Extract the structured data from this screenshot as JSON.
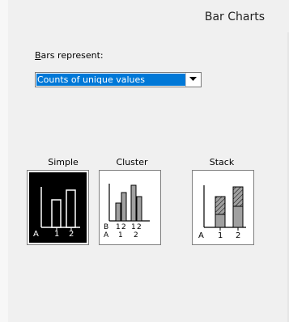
{
  "window": {
    "title": "Bar Charts"
  },
  "bars_represent": {
    "label_prefix": "",
    "label_underlined": "B",
    "label_rest": "ars represent:",
    "selected_value": "Counts of unique values"
  },
  "chart_types": [
    {
      "label": "Simple",
      "selected": true,
      "axis": {
        "row1": "",
        "row2": [
          "A",
          "1",
          "2"
        ]
      }
    },
    {
      "label": "Cluster",
      "selected": false,
      "axis": {
        "row1": [
          "B",
          "1",
          "2",
          "1",
          "2"
        ],
        "row2": [
          "A",
          "1",
          "2"
        ]
      }
    },
    {
      "label": "Stack",
      "selected": false,
      "axis": {
        "row1": "",
        "row2": [
          "A",
          "1",
          "2"
        ]
      }
    }
  ],
  "colors": {
    "accent": "#0078d7",
    "selected_bg": "#000000",
    "bar_fill": "#a0a0a0"
  }
}
